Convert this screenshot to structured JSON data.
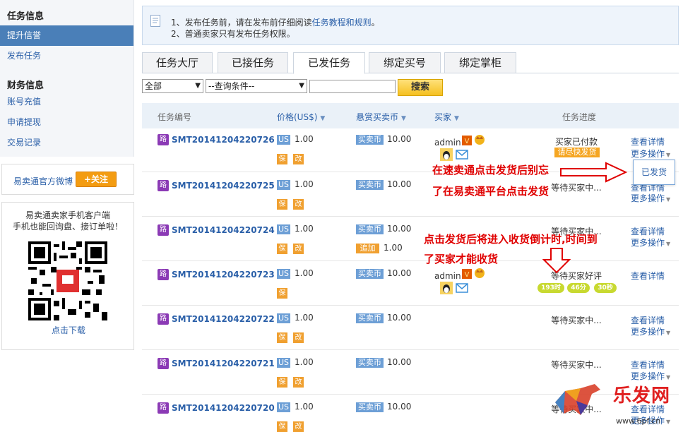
{
  "sidebar": {
    "task_title": "任务信息",
    "task_items": [
      "提升信誉",
      "发布任务"
    ],
    "finance_title": "财务信息",
    "finance_items": [
      "账号充值",
      "申请提现",
      "交易记录"
    ],
    "weibo_label": "易卖通官方微博",
    "follow_label": "+关注",
    "app_line1": "易卖通卖家手机客户端",
    "app_line2": "手机也能回询盘、接订单啦！",
    "app_download": "点击下载"
  },
  "notice": {
    "line1_prefix": "1、发布任务前，请在发布前仔细阅读",
    "line1_link": "任务教程和规则",
    "line1_suffix": "。",
    "line2": "2、普通卖家只有发布任务权限。"
  },
  "tabs": [
    "任务大厅",
    "已接任务",
    "已发任务",
    "绑定买号",
    "绑定掌柜"
  ],
  "active_tab": 2,
  "filters": {
    "select1": "全部",
    "select2": "--查询条件--",
    "search_value": "",
    "search_button": "搜索"
  },
  "table": {
    "headers": {
      "id": "任务编号",
      "price": "价格(US$)",
      "coin": "悬赏买卖币",
      "buyer": "买家",
      "progress": "任务进度"
    },
    "labels": {
      "lu": "路",
      "us": "US",
      "bao": "保",
      "gai": "改",
      "coin_tag": "买卖币",
      "add_tag": "追加",
      "view_detail": "查看详情",
      "more_ops": "更多操作",
      "hurry": "请尽快发货"
    },
    "rows": [
      {
        "id": "SMT20141204220726",
        "price": "1.00",
        "coin": "10.00",
        "buyer": "admin",
        "status": "买家已付款"
      },
      {
        "id": "SMT20141204220725",
        "price": "1.00",
        "coin": "10.00",
        "buyer": "",
        "status": "等待买家中..."
      },
      {
        "id": "SMT20141204220724",
        "price": "1.00",
        "coin": "10.00",
        "add": "1.00",
        "buyer": "",
        "status": "等待买家中..."
      },
      {
        "id": "SMT20141204220723",
        "price": "1.00",
        "coin": "10.00",
        "buyer": "admin",
        "status": "等待买家好评",
        "timer": [
          "193时",
          "46分",
          "30秒"
        ]
      },
      {
        "id": "SMT20141204220722",
        "price": "1.00",
        "coin": "10.00",
        "buyer": "",
        "status": "等待买家中..."
      },
      {
        "id": "SMT20141204220721",
        "price": "1.00",
        "coin": "10.00",
        "buyer": "",
        "status": "等待买家中..."
      },
      {
        "id": "SMT20141204220720",
        "price": "1.00",
        "coin": "10.00",
        "buyer": "",
        "status": "等待买家中..."
      }
    ]
  },
  "popup_ship": "已发货",
  "annotation1_line1": "在速卖通点击发货后别忘",
  "annotation1_line2": "了在易卖通平台点击发货",
  "annotation2_line1": "点击发货后将进入收货倒计时,时间到",
  "annotation2_line2": "了买家才能收货",
  "watermark_text": "乐发网",
  "watermark_url": "www.6pf.cn",
  "colors": {
    "accent": "#4a7fb8",
    "link": "#2a5fa8",
    "annotation": "#e00000",
    "button": "#f5c020"
  }
}
